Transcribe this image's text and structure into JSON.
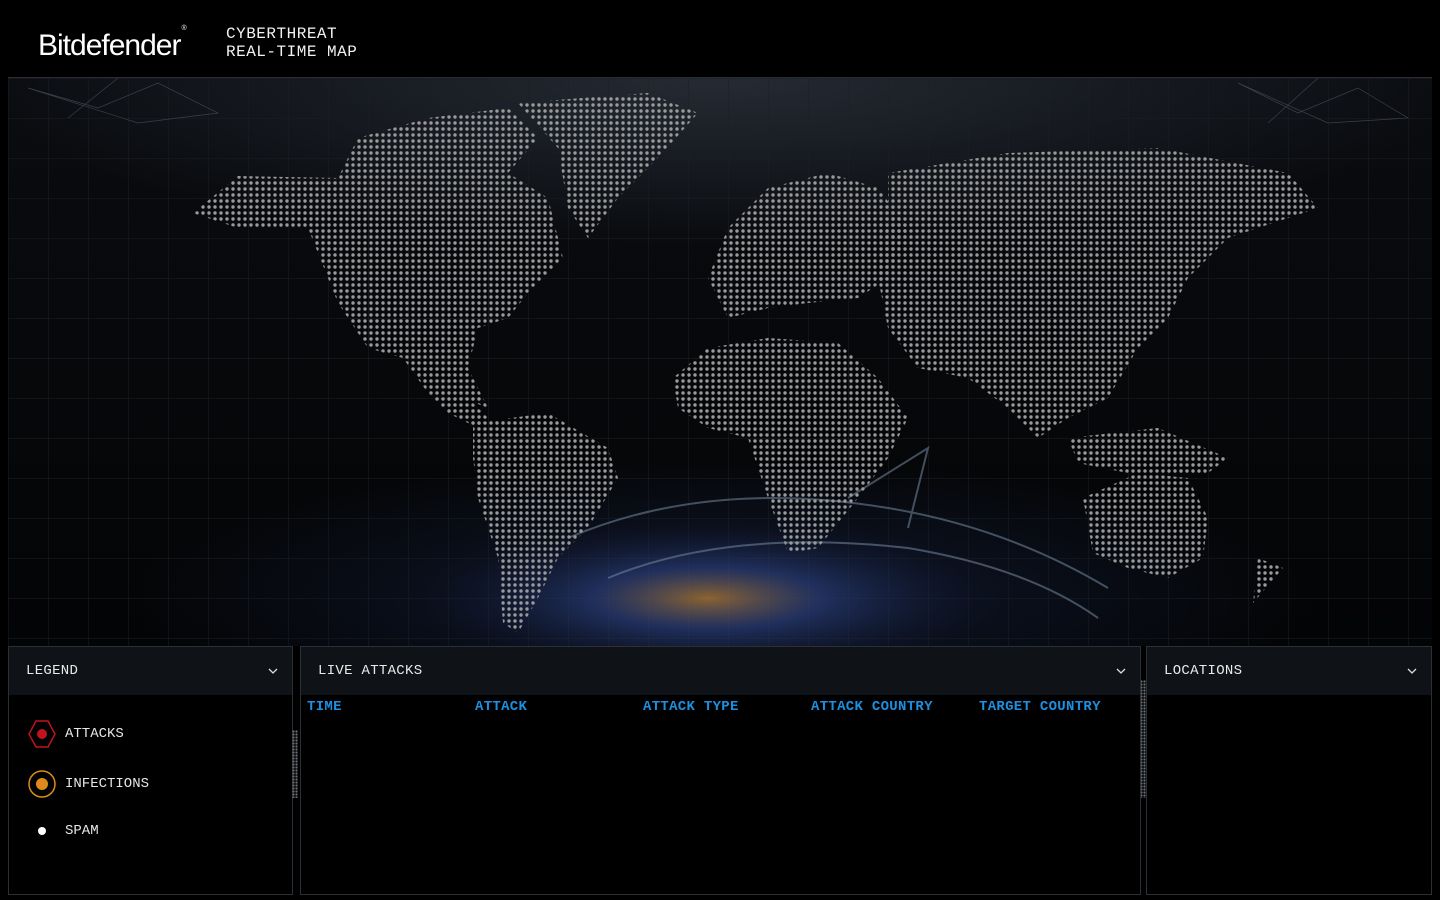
{
  "header": {
    "brand": "Bitdefender",
    "brand_mark": "®",
    "title_line1": "CYBERTHREAT",
    "title_line2": "REAL-TIME MAP"
  },
  "legend": {
    "title": "LEGEND",
    "items": [
      {
        "label": "ATTACKS",
        "color": "#c1121f"
      },
      {
        "label": "INFECTIONS",
        "color": "#e08a1e"
      },
      {
        "label": "SPAM",
        "color": "#ffffff"
      }
    ]
  },
  "live_attacks": {
    "title": "LIVE ATTACKS",
    "columns": [
      "TIME",
      "ATTACK",
      "ATTACK TYPE",
      "ATTACK COUNTRY",
      "TARGET COUNTRY"
    ],
    "rows": []
  },
  "locations": {
    "title": "LOCATIONS"
  },
  "colors": {
    "accent": "#1e8fe0",
    "map_dot": "#9a9a9a",
    "panel_header": "#0f1216"
  },
  "icons": {
    "panel_toggle": "chevron-down-icon",
    "attacks": "hexagon-red-icon",
    "infections": "circle-orange-icon",
    "spam": "dot-white-icon"
  }
}
